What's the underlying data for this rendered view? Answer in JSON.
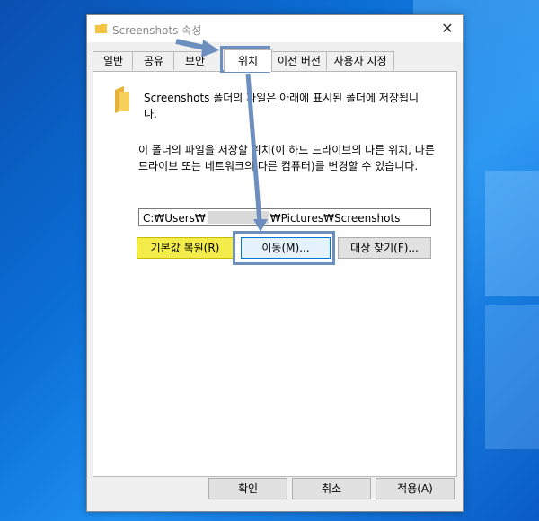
{
  "dialog": {
    "title": "Screenshots 속성",
    "close_symbol": "✕"
  },
  "tabs": [
    {
      "label": "일반"
    },
    {
      "label": "공유"
    },
    {
      "label": "보안"
    },
    {
      "label": "위치"
    },
    {
      "label": "이전 버전"
    },
    {
      "label": "사용자 지정"
    }
  ],
  "active_tab": "위치",
  "location": {
    "description1": "Screenshots 폴더의 파일은 아래에 표시된 폴더에 저장됩니다.",
    "description2": "이 폴더의 파일을 저장할 위치(이 하드 드라이브의 다른 위치, 다른 드라이브 또는 네트워크의 다른 컴퓨터)를 변경할 수 있습니다.",
    "path_prefix": "C:₩Users₩",
    "path_suffix": "₩Pictures₩Screenshots",
    "restore_label": "기본값 복원(R)",
    "move_label": "이동(M)...",
    "find_label": "대상 찾기(F)..."
  },
  "footer": {
    "ok_label": "확인",
    "cancel_label": "취소",
    "apply_label": "적용(A)"
  },
  "colors": {
    "highlight_yellow": "#f3ec4a",
    "annotation_blue": "#6d8fbf",
    "desktop_blue": "#0b6fd6"
  }
}
